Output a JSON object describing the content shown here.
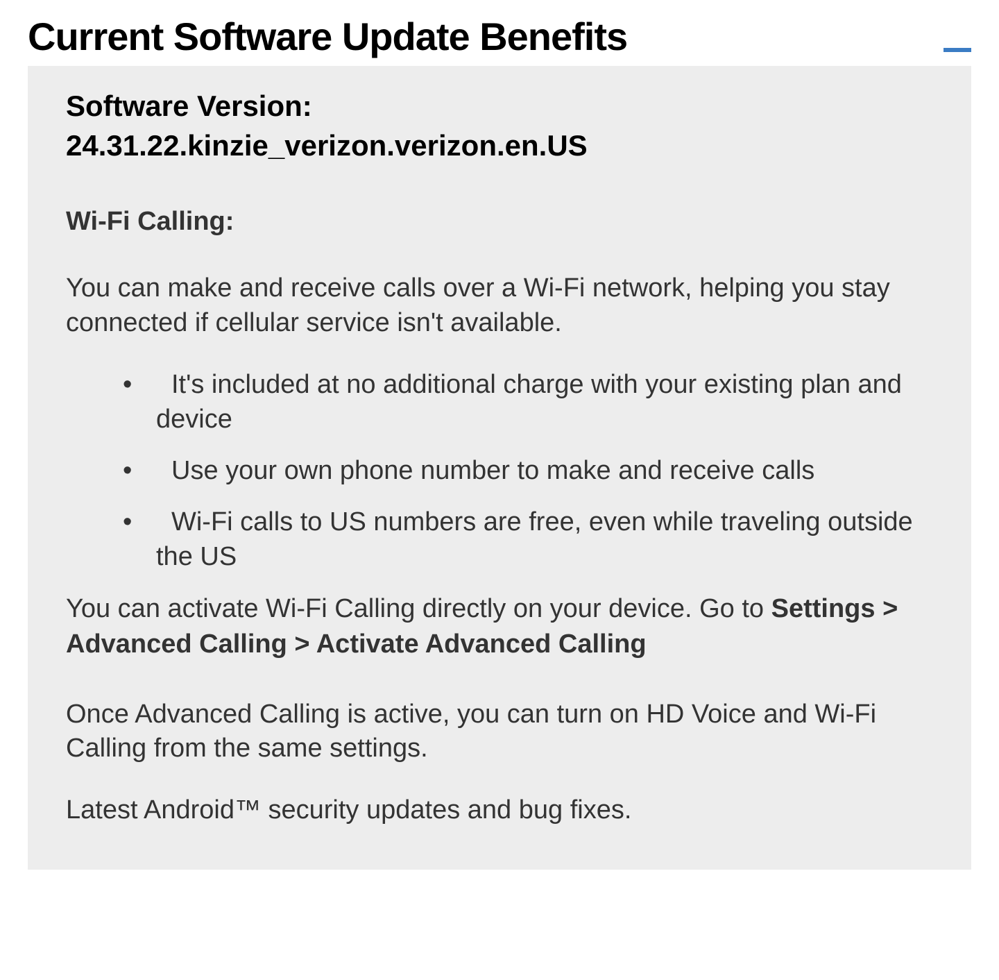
{
  "header": {
    "title": "Current Software Update Benefits"
  },
  "content": {
    "version_label": "Software Version:",
    "version_value": "24.31.22.kinzie_verizon.verizon.en.US",
    "section_heading": "Wi-Fi Calling:",
    "intro_paragraph": "You can make and receive calls over a Wi-Fi network, helping you stay connected if cellular service isn't available.",
    "bullets": [
      "It's included at no additional charge with your existing plan and device",
      "Use your own phone number to make and receive calls",
      "Wi-Fi calls to US numbers are free, even while traveling outside the US"
    ],
    "activate_prefix": "You can activate Wi-Fi Calling directly on your device. Go to ",
    "activate_path": "Settings > Advanced Calling > Activate Advanced Calling",
    "hdvoice_text": "Once Advanced Calling is active, you can turn on HD Voice and Wi-Fi Calling from the same settings.",
    "footer_text": "Latest Android™ security updates and bug fixes."
  }
}
